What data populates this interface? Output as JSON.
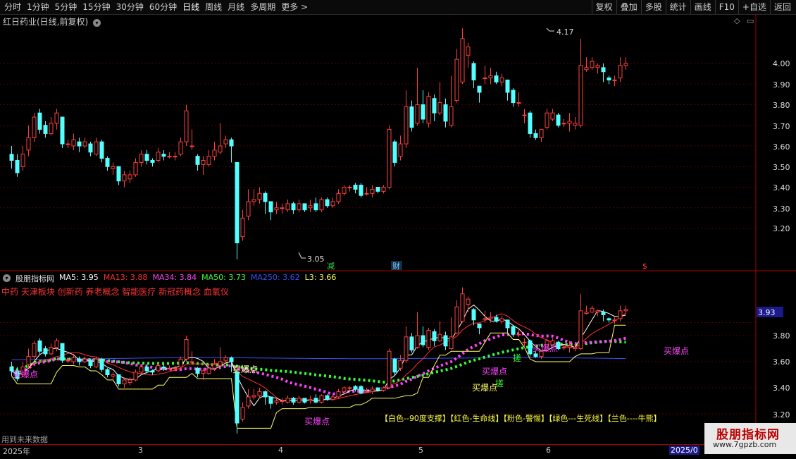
{
  "toolbar": {
    "periods": [
      "分时",
      "1分钟",
      "5分钟",
      "15分钟",
      "30分钟",
      "60分钟",
      "日线",
      "周线",
      "月线",
      "多周期",
      "更多 >"
    ],
    "actions": [
      "复权",
      "叠加",
      "多股",
      "统计",
      "画线",
      "F10",
      "+自选",
      "返回"
    ],
    "active_period": "日线"
  },
  "price_panel": {
    "title": "红日药业(日线,前复权)",
    "axis_labels": [
      "4.00",
      "3.90",
      "3.80",
      "3.70",
      "3.60",
      "3.50",
      "3.40",
      "3.30",
      "3.20"
    ],
    "high_label": "4.17",
    "low_label": "3.05",
    "markers": [
      "减",
      "财",
      "$"
    ]
  },
  "indicator_panel": {
    "name": "股朋指标网",
    "ma": [
      {
        "label": "MA5: 3.95",
        "color": "#ffffff"
      },
      {
        "label": "MA13: 3.88",
        "color": "#ff3030"
      },
      {
        "label": "MA34: 3.84",
        "color": "#ff33ff"
      },
      {
        "label": "MA50: 3.73",
        "color": "#33ff33"
      },
      {
        "label": "MA250: 3.62",
        "color": "#3355ff"
      },
      {
        "label": "L3: 3.66",
        "color": "#ffff66"
      }
    ],
    "concepts": "中药 天津板块 创新药 养老概念 智能医疗 新冠药概念 血氧仪",
    "axis_labels": [
      "3.93",
      "3.80",
      "3.60",
      "3.40",
      "3.20"
    ],
    "current_value": "3.93",
    "signals": [
      "买爆点",
      "买爆点",
      "买爆点",
      "买爆点",
      "买爆点",
      "买爆点",
      "搓",
      "搓",
      "买爆点"
    ],
    "legend_note": "【白色--90度支撑】【红色-生命线】【粉色-警惕】【绿色---生死线】【兰色----牛熊】",
    "future_note": "用到未来数据"
  },
  "date_axis": [
    "2025年",
    "3",
    "4",
    "5",
    "6",
    "2025/0"
  ],
  "watermark": {
    "title": "股朋指标网",
    "url": "www.7gpzb.com"
  },
  "colors": {
    "up": "#ff4040",
    "down": "#54ffff",
    "bg": "#000000",
    "grid": "#5a0000"
  },
  "chart_data": {
    "type": "candlestick",
    "ylim": [
      3.05,
      4.22
    ],
    "candles": [
      [
        3.56,
        3.53,
        3.6,
        3.49
      ],
      [
        3.53,
        3.47,
        3.56,
        3.45
      ],
      [
        3.5,
        3.56,
        3.6,
        3.48
      ],
      [
        3.58,
        3.64,
        3.7,
        3.55
      ],
      [
        3.64,
        3.74,
        3.76,
        3.62
      ],
      [
        3.76,
        3.68,
        3.78,
        3.66
      ],
      [
        3.7,
        3.66,
        3.72,
        3.64
      ],
      [
        3.66,
        3.71,
        3.74,
        3.65
      ],
      [
        3.71,
        3.76,
        3.78,
        3.68
      ],
      [
        3.74,
        3.61,
        3.74,
        3.59
      ],
      [
        3.61,
        3.61,
        3.63,
        3.59
      ],
      [
        3.6,
        3.63,
        3.66,
        3.58
      ],
      [
        3.62,
        3.6,
        3.64,
        3.57
      ],
      [
        3.6,
        3.62,
        3.64,
        3.59
      ],
      [
        3.61,
        3.57,
        3.62,
        3.55
      ],
      [
        3.56,
        3.62,
        3.64,
        3.55
      ],
      [
        3.62,
        3.54,
        3.63,
        3.52
      ],
      [
        3.54,
        3.5,
        3.55,
        3.48
      ],
      [
        3.49,
        3.5,
        3.52,
        3.46
      ],
      [
        3.5,
        3.43,
        3.5,
        3.41
      ],
      [
        3.43,
        3.46,
        3.48,
        3.4
      ],
      [
        3.44,
        3.46,
        3.48,
        3.42
      ],
      [
        3.46,
        3.52,
        3.54,
        3.45
      ],
      [
        3.52,
        3.56,
        3.58,
        3.5
      ],
      [
        3.56,
        3.53,
        3.58,
        3.51
      ],
      [
        3.53,
        3.52,
        3.54,
        3.5
      ],
      [
        3.53,
        3.57,
        3.59,
        3.52
      ],
      [
        3.56,
        3.55,
        3.58,
        3.53
      ],
      [
        3.55,
        3.55,
        3.57,
        3.54
      ],
      [
        3.55,
        3.55,
        3.57,
        3.53
      ],
      [
        3.56,
        3.62,
        3.64,
        3.55
      ],
      [
        3.62,
        3.77,
        3.8,
        3.6
      ],
      [
        3.6,
        3.6,
        3.68,
        3.58
      ],
      [
        3.55,
        3.51,
        3.56,
        3.48
      ],
      [
        3.51,
        3.53,
        3.55,
        3.46
      ],
      [
        3.51,
        3.55,
        3.58,
        3.5
      ],
      [
        3.55,
        3.58,
        3.62,
        3.53
      ],
      [
        3.57,
        3.6,
        3.71,
        3.56
      ],
      [
        3.61,
        3.63,
        3.65,
        3.59
      ],
      [
        3.63,
        3.6,
        3.64,
        3.52
      ],
      [
        3.52,
        3.13,
        3.52,
        3.05
      ],
      [
        3.16,
        3.25,
        3.29,
        3.14
      ],
      [
        3.26,
        3.33,
        3.39,
        3.24
      ],
      [
        3.33,
        3.34,
        3.39,
        3.31
      ],
      [
        3.34,
        3.37,
        3.4,
        3.32
      ],
      [
        3.37,
        3.33,
        3.38,
        3.27
      ],
      [
        3.33,
        3.28,
        3.33,
        3.24
      ],
      [
        3.29,
        3.3,
        3.33,
        3.27
      ],
      [
        3.3,
        3.3,
        3.32,
        3.27
      ],
      [
        3.29,
        3.32,
        3.34,
        3.28
      ],
      [
        3.32,
        3.29,
        3.33,
        3.27
      ],
      [
        3.29,
        3.32,
        3.34,
        3.28
      ],
      [
        3.32,
        3.29,
        3.32,
        3.28
      ],
      [
        3.3,
        3.31,
        3.34,
        3.28
      ],
      [
        3.32,
        3.29,
        3.35,
        3.28
      ],
      [
        3.29,
        3.34,
        3.35,
        3.28
      ],
      [
        3.34,
        3.31,
        3.35,
        3.3
      ],
      [
        3.31,
        3.33,
        3.35,
        3.3
      ],
      [
        3.33,
        3.37,
        3.39,
        3.32
      ],
      [
        3.37,
        3.4,
        3.41,
        3.36
      ],
      [
        3.4,
        3.4,
        3.41,
        3.38
      ],
      [
        3.41,
        3.39,
        3.42,
        3.37
      ],
      [
        3.41,
        3.36,
        3.42,
        3.35
      ],
      [
        3.37,
        3.37,
        3.4,
        3.36
      ],
      [
        3.37,
        3.39,
        3.41,
        3.35
      ],
      [
        3.4,
        3.38,
        3.4,
        3.37
      ],
      [
        3.38,
        3.4,
        3.41,
        3.37
      ],
      [
        3.4,
        3.68,
        3.7,
        3.39
      ],
      [
        3.62,
        3.52,
        3.63,
        3.5
      ],
      [
        3.55,
        3.61,
        3.65,
        3.53
      ],
      [
        3.61,
        3.79,
        3.87,
        3.59
      ],
      [
        3.79,
        3.69,
        3.82,
        3.67
      ],
      [
        3.71,
        3.8,
        3.98,
        3.7
      ],
      [
        3.8,
        3.73,
        3.87,
        3.71
      ],
      [
        3.71,
        3.84,
        3.86,
        3.69
      ],
      [
        3.83,
        3.76,
        3.85,
        3.72
      ],
      [
        3.76,
        3.81,
        3.91,
        3.75
      ],
      [
        3.8,
        3.72,
        3.83,
        3.69
      ],
      [
        3.7,
        3.79,
        3.94,
        3.69
      ],
      [
        3.82,
        4.02,
        4.07,
        3.81
      ],
      [
        3.91,
        4.12,
        4.17,
        3.9
      ],
      [
        4.04,
        4.08,
        4.1,
        3.98
      ],
      [
        4.0,
        3.92,
        4.01,
        3.88
      ],
      [
        3.89,
        3.86,
        3.89,
        3.81
      ],
      [
        3.93,
        3.93,
        3.99,
        3.9
      ],
      [
        3.93,
        3.94,
        3.98,
        3.9
      ],
      [
        3.94,
        3.91,
        3.96,
        3.9
      ],
      [
        3.91,
        3.93,
        3.95,
        3.89
      ],
      [
        3.92,
        3.86,
        3.92,
        3.82
      ],
      [
        3.87,
        3.81,
        3.88,
        3.79
      ],
      [
        3.81,
        3.81,
        3.86,
        3.79
      ],
      [
        3.75,
        3.75,
        3.78,
        3.71
      ],
      [
        3.76,
        3.66,
        3.77,
        3.64
      ],
      [
        3.66,
        3.64,
        3.68,
        3.63
      ],
      [
        3.64,
        3.68,
        3.68,
        3.62
      ],
      [
        3.69,
        3.76,
        3.78,
        3.68
      ],
      [
        3.73,
        3.76,
        3.78,
        3.72
      ],
      [
        3.75,
        3.7,
        3.76,
        3.69
      ],
      [
        3.71,
        3.71,
        3.73,
        3.69
      ],
      [
        3.71,
        3.72,
        3.76,
        3.67
      ],
      [
        3.7,
        3.71,
        3.74,
        3.68
      ],
      [
        3.7,
        3.99,
        4.12,
        3.69
      ],
      [
        3.97,
        3.98,
        4.03,
        3.96
      ],
      [
        3.98,
        4.01,
        4.03,
        3.97
      ],
      [
        3.98,
        3.99,
        4.0,
        3.95
      ],
      [
        3.98,
        3.96,
        4.0,
        3.91
      ],
      [
        3.93,
        3.92,
        3.94,
        3.9
      ],
      [
        3.92,
        3.92,
        3.94,
        3.89
      ],
      [
        3.93,
        3.99,
        4.03,
        3.91
      ],
      [
        3.99,
        4.0,
        4.03,
        3.97
      ]
    ]
  }
}
